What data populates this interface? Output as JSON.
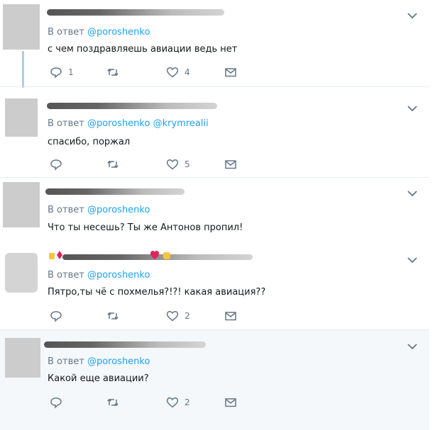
{
  "tweets": [
    {
      "reply_label": "В ответ",
      "mentions": [
        "@poroshenko"
      ],
      "text": "с чем поздравляешь авиации ведь нет",
      "replies": "1",
      "retweets": "",
      "likes": "4"
    },
    {
      "reply_label": "В ответ",
      "mentions": [
        "@poroshenko",
        "@krymrealii"
      ],
      "text": "спасибо, поржал",
      "replies": "",
      "retweets": "",
      "likes": "5"
    },
    {
      "reply_label": "В ответ",
      "mentions": [
        "@poroshenko"
      ],
      "text": "Что ты несешь? Ты же Антонов пропил!",
      "replies": "",
      "retweets": "",
      "likes": ""
    },
    {
      "reply_label": "В ответ",
      "mentions": [
        "@poroshenko"
      ],
      "text": "Пятро,ты чё с похмелья?!?! какая авиация??",
      "replies": "",
      "retweets": "",
      "likes": "2"
    },
    {
      "reply_label": "В ответ",
      "mentions": [
        "@poroshenko"
      ],
      "text": "Какой еще авиации?",
      "replies": "",
      "retweets": "",
      "likes": "2"
    }
  ],
  "icons": {
    "reply": "reply-icon",
    "retweet": "retweet-icon",
    "like": "heart-icon",
    "message": "envelope-icon",
    "more": "chevron-down-icon"
  },
  "colors": {
    "link": "#1da1f2",
    "muted": "#657786",
    "thread_line": "#a6d0ea",
    "highlight_bg": "#f5f8fa"
  }
}
